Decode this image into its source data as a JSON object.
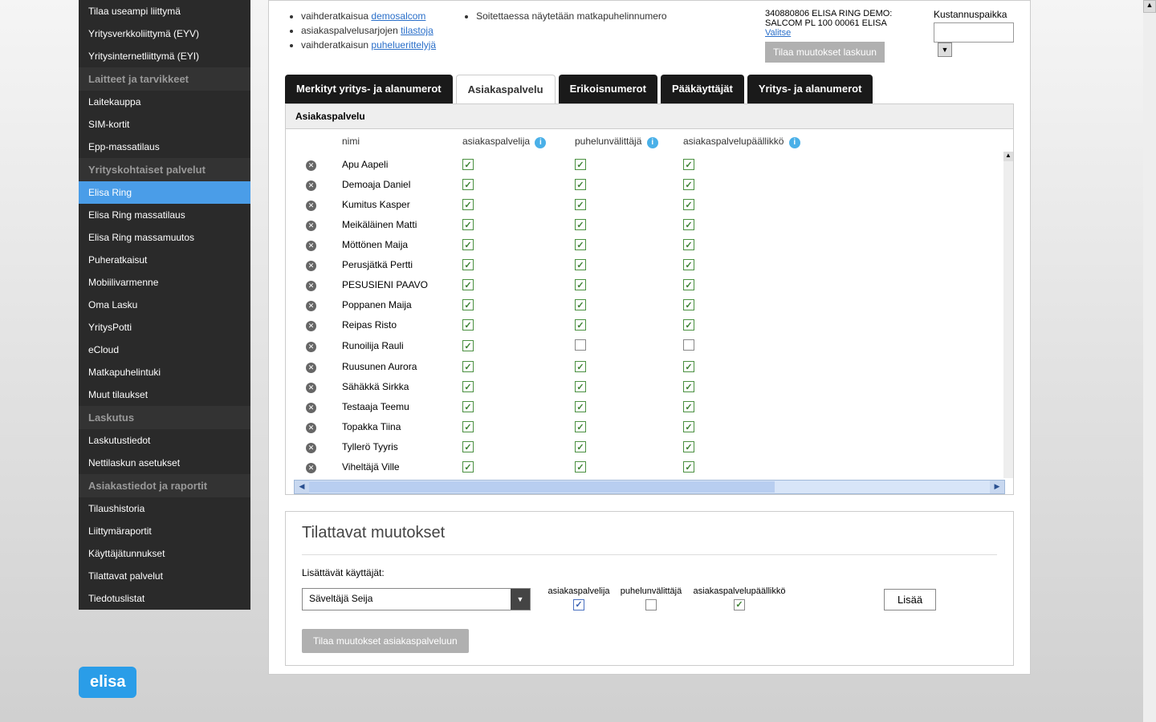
{
  "sidebar": {
    "items": [
      {
        "type": "item",
        "label": "Tilaa useampi liittymä"
      },
      {
        "type": "item",
        "label": "Yritysverkkoliittymä (EYV)"
      },
      {
        "type": "item",
        "label": "Yritysinternetliittymä (EYI)"
      },
      {
        "type": "header",
        "label": "Laitteet ja tarvikkeet"
      },
      {
        "type": "item",
        "label": "Laitekauppa"
      },
      {
        "type": "item",
        "label": "SIM-kortit"
      },
      {
        "type": "item",
        "label": "Epp-massatilaus"
      },
      {
        "type": "header",
        "label": "Yrityskohtaiset palvelut"
      },
      {
        "type": "item",
        "label": "Elisa Ring",
        "selected": true
      },
      {
        "type": "item",
        "label": "Elisa Ring massatilaus"
      },
      {
        "type": "item",
        "label": "Elisa Ring massamuutos"
      },
      {
        "type": "item",
        "label": "Puheratkaisut"
      },
      {
        "type": "item",
        "label": "Mobiilivarmenne"
      },
      {
        "type": "item",
        "label": "Oma Lasku"
      },
      {
        "type": "item",
        "label": "YritysPotti"
      },
      {
        "type": "item",
        "label": "eCloud"
      },
      {
        "type": "item",
        "label": "Matkapuhelintuki"
      },
      {
        "type": "item",
        "label": "Muut tilaukset"
      },
      {
        "type": "header",
        "label": "Laskutus"
      },
      {
        "type": "item",
        "label": "Laskutustiedot"
      },
      {
        "type": "item",
        "label": "Nettilaskun asetukset"
      },
      {
        "type": "header",
        "label": "Asiakastiedot ja raportit"
      },
      {
        "type": "item",
        "label": "Tilaushistoria"
      },
      {
        "type": "item",
        "label": "Liittymäraportit"
      },
      {
        "type": "item",
        "label": "Käyttäjätunnukset"
      },
      {
        "type": "item",
        "label": "Tilattavat palvelut"
      },
      {
        "type": "item",
        "label": "Tiedotuslistat"
      }
    ]
  },
  "top": {
    "b1_pre": "vaihderatkaisua ",
    "b1_link": "demosalcom",
    "b2_pre": "asiakaspalvelusarjojen ",
    "b2_link": "tilastoja",
    "b3_pre": "vaihderatkaisun ",
    "b3_link": "puheluerittelyjä",
    "b4": "Soitettaessa näytetään matkapuhelinnumero",
    "account": "340880806 ELISA RING DEMO: SALCOM PL 100 00061 ELISA",
    "account_link": "Valitse",
    "cost_label": "Kustannuspaikka",
    "order_btn": "Tilaa muutokset laskuun"
  },
  "tabs": [
    "Merkityt yritys- ja alanumerot",
    "Asiakaspalvelu",
    "Erikoisnumerot",
    "Pääkäyttäjät",
    "Yritys- ja alanumerot"
  ],
  "active_tab": 1,
  "panel_title": "Asiakaspalvelu",
  "cols": {
    "name": "nimi",
    "a": "asiakaspalvelija",
    "b": "puhelunvälittäjä",
    "c": "asiakaspalvelupäällikkö"
  },
  "rows": [
    {
      "name": "Apu Aapeli",
      "a": true,
      "b": true,
      "c": true
    },
    {
      "name": "Demoaja Daniel",
      "a": true,
      "b": true,
      "c": true
    },
    {
      "name": "Kumitus Kasper",
      "a": true,
      "b": true,
      "c": true
    },
    {
      "name": "Meikäläinen Matti",
      "a": true,
      "b": true,
      "c": true
    },
    {
      "name": "Möttönen Maija",
      "a": true,
      "b": true,
      "c": true
    },
    {
      "name": "Perusjätkä Pertti",
      "a": true,
      "b": true,
      "c": true
    },
    {
      "name": "PESUSIENI PAAVO",
      "a": true,
      "b": true,
      "c": true
    },
    {
      "name": "Poppanen Maija",
      "a": true,
      "b": true,
      "c": true
    },
    {
      "name": "Reipas Risto",
      "a": true,
      "b": true,
      "c": true
    },
    {
      "name": "Runoilija Rauli",
      "a": true,
      "b": false,
      "c": false
    },
    {
      "name": "Ruusunen Aurora",
      "a": true,
      "b": true,
      "c": true
    },
    {
      "name": "Sähäkkä Sirkka",
      "a": true,
      "b": true,
      "c": true
    },
    {
      "name": "Testaaja Teemu",
      "a": true,
      "b": true,
      "c": true
    },
    {
      "name": "Topakka Tiina",
      "a": true,
      "b": true,
      "c": true
    },
    {
      "name": "Tyllerö Tyyris",
      "a": true,
      "b": true,
      "c": true
    },
    {
      "name": "Viheltäjä Ville",
      "a": true,
      "b": true,
      "c": true
    }
  ],
  "changes": {
    "title": "Tilattavat muutokset",
    "add_label": "Lisättävät käyttäjät:",
    "user": "Säveltäjä Seija",
    "col_a": "asiakaspalvelija",
    "col_b": "puhelunvälittäjä",
    "col_c": "asiakaspalvelupäällikkö",
    "chk_a": true,
    "chk_b": false,
    "chk_c": true,
    "add_btn": "Lisää",
    "submit_btn": "Tilaa muutokset asiakaspalveluun"
  },
  "logo": "elisa"
}
